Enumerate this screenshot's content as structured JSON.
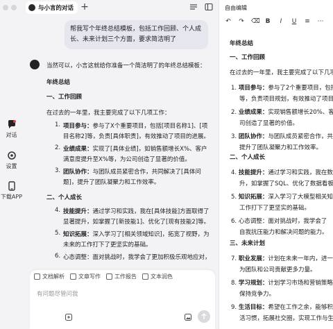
{
  "tab": {
    "title": "与小言的对话"
  },
  "rail": {
    "chat": "对话",
    "settings": "设置",
    "download": "下载APP"
  },
  "user_message": "帮我写个年终总结模板，包括工作回顾、个人成长、未来计划三个方面，要求简洁明了",
  "answer": {
    "intro": "当然可以，小言这就给你准备一个简洁明了的年终总结模板：",
    "title": "年终总结",
    "sec1": "一、工作回顾",
    "sec1_intro": "在过去的一年里，我主要完成了以下几项工作：",
    "sec1_items": [
      {
        "num": "1.",
        "label": "项目参与：",
        "text": "参与了X个重要项目，包括[项目名称1]、[项目名称2]等，负责[具体职责]，有效推动了项目的进展。"
      },
      {
        "num": "2.",
        "label": "业绩成果：",
        "text": "实现了[具体业绩]，如销售额增长X%、客户满意度提升至X%等，为公司创造了显著的价值。"
      },
      {
        "num": "3.",
        "label": "团队协作：",
        "text": "与团队成员紧密合作，共同解决了[具体问题]，提升了团队凝聚力和工作效率。"
      }
    ],
    "sec2": "二、个人成长",
    "sec2_items": [
      {
        "num": "4.",
        "label": "技能提升：",
        "text": "通过学习和实践，我在[具体技能]方面取得了显著提升，如掌握了[新技能1]、优化了[现有技能2]等。"
      },
      {
        "num": "5.",
        "label": "知识拓展：",
        "text": "深入学习了[相关领域知识]，拓宽了视野，为未来的工作打下了更坚实的基础。"
      },
      {
        "num": "6.",
        "label": "",
        "text": "心态调整：面对挑战时，我学会了更加积极乐观地应对，"
      }
    ]
  },
  "input": {
    "chips": [
      "文档解析",
      "文章写作",
      "工作报告",
      "文本润色"
    ],
    "placeholder": "有问题尽管问我"
  },
  "editor": {
    "title": "自由编辑",
    "doc_title": "年终总结",
    "sec1": "一、工作回顾",
    "sec1_intro": "在过去的一年里，我主要完成了以下几项",
    "items1": [
      {
        "num": "1.",
        "label": "项目参与：",
        "l1": "参与了2个重要项目，包括",
        "l2": "等，负责项目规划，有效推动了项目的"
      },
      {
        "num": "2.",
        "label": "业绩成果：",
        "l1": "实现销售额增长20%、客",
        "l2": "司创造了显著的价值。"
      },
      {
        "num": "3.",
        "label": "团队协作：",
        "l1": "与团队成员紧密合作，共同",
        "l2": "提升了团队凝聚力和工作效率。"
      }
    ],
    "sec2": "二、个人成长",
    "items2": [
      {
        "num": "4.",
        "label": "技能提升：",
        "l1": "通过学习和实践，我在数据",
        "l2": "升，如掌握了SQL、优化了数据看板"
      },
      {
        "num": "5.",
        "label": "知识拓展：",
        "l1": "深入学习了大模型相关知识",
        "l2": "工作打下了更坚实的基础。"
      },
      {
        "num": "6.",
        "label": "",
        "l1": "心态调整：面对挑战时，我学会了",
        "l2": "自我抗压能力和解决问题的能力。"
      }
    ],
    "sec3": "三、未来计划",
    "items3": [
      {
        "num": "7.",
        "label": "职业发展：",
        "l1": "计划在未来一年内，进一步",
        "l2": "为团队和公司贡献更多力量。"
      },
      {
        "num": "8.",
        "label": "学习规划：",
        "l1": "计划学习市场和营销策略，",
        "l2": "保持竞争力。"
      },
      {
        "num": "9.",
        "label": "生活目标：",
        "l1": "希望在工作之余，能够积极",
        "l2": "活习惯，拓展社交圈，实现工作与生活"
      }
    ]
  }
}
